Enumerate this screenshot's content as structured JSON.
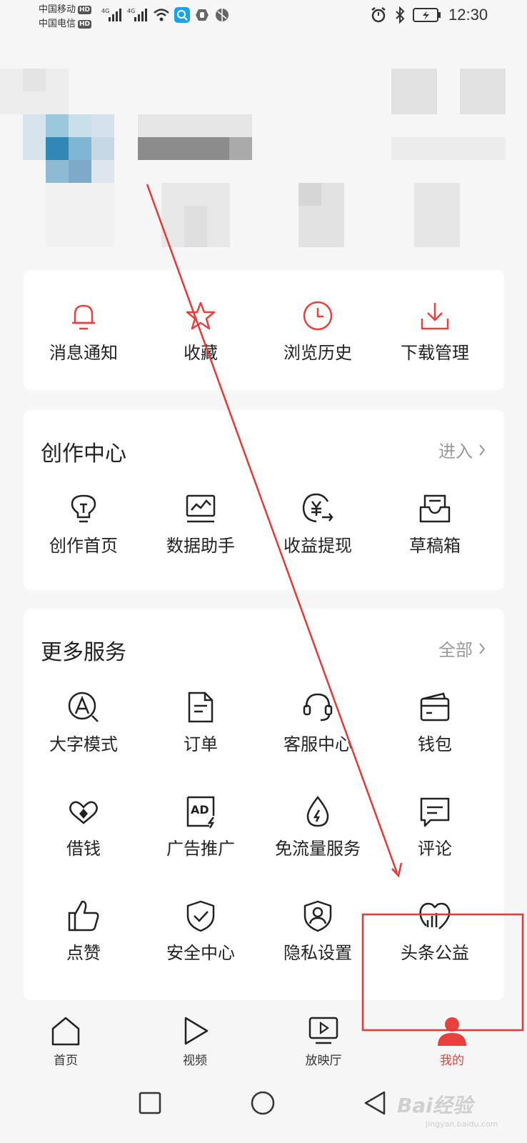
{
  "status_bar": {
    "carrier1": "中国移动",
    "carrier2": "中国电信",
    "hd": "HD",
    "network": "4G",
    "time": "12:30"
  },
  "quick_actions": [
    {
      "label": "消息通知",
      "icon": "bell-icon"
    },
    {
      "label": "收藏",
      "icon": "star-icon"
    },
    {
      "label": "浏览历史",
      "icon": "clock-icon"
    },
    {
      "label": "下载管理",
      "icon": "download-icon"
    }
  ],
  "creation": {
    "title": "创作中心",
    "enter": "进入",
    "items": [
      {
        "label": "创作首页",
        "icon": "lightbulb-icon"
      },
      {
        "label": "数据助手",
        "icon": "chart-monitor-icon"
      },
      {
        "label": "收益提现",
        "icon": "yuan-transfer-icon"
      },
      {
        "label": "草稿箱",
        "icon": "draft-box-icon"
      }
    ]
  },
  "services": {
    "title": "更多服务",
    "all": "全部",
    "items": [
      {
        "label": "大字模式",
        "icon": "font-size-icon"
      },
      {
        "label": "订单",
        "icon": "document-icon"
      },
      {
        "label": "客服中心",
        "icon": "headset-icon"
      },
      {
        "label": "钱包",
        "icon": "wallet-icon"
      },
      {
        "label": "借钱",
        "icon": "coin-loan-icon"
      },
      {
        "label": "广告推广",
        "icon": "ad-icon"
      },
      {
        "label": "免流量服务",
        "icon": "data-drop-icon"
      },
      {
        "label": "评论",
        "icon": "comment-icon"
      },
      {
        "label": "点赞",
        "icon": "thumbs-up-icon"
      },
      {
        "label": "安全中心",
        "icon": "shield-check-icon"
      },
      {
        "label": "隐私设置",
        "icon": "privacy-user-icon"
      },
      {
        "label": "头条公益",
        "icon": "charity-heart-icon"
      }
    ]
  },
  "bottom_nav": [
    {
      "label": "首页",
      "icon": "home-icon"
    },
    {
      "label": "视频",
      "icon": "play-icon"
    },
    {
      "label": "放映厅",
      "icon": "tv-play-icon"
    },
    {
      "label": "我的",
      "icon": "user-icon",
      "active": true
    }
  ],
  "watermark": {
    "brand": "Bai经验",
    "url": "jingyan.baidu.com"
  },
  "colors": {
    "accent": "#e8403d",
    "annotation": "#e53935",
    "text": "#222222",
    "muted": "#999999"
  }
}
